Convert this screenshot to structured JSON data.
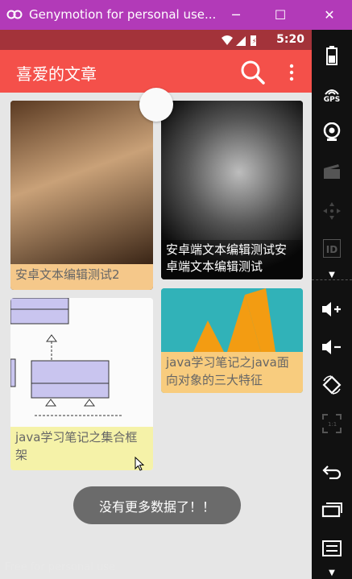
{
  "window": {
    "title": "Genymotion for personal use...",
    "minimize": "─",
    "maximize": "☐",
    "close": "✕"
  },
  "statusbar": {
    "time": "5:20"
  },
  "appbar": {
    "title": "喜爱的文章",
    "icons": [
      "search-icon",
      "more-vert-icon"
    ]
  },
  "cards": [
    {
      "caption": "安卓文本编辑测试2"
    },
    {
      "caption": "安卓端文本编辑测试安卓端文本编辑测试"
    },
    {
      "caption": "java学习笔记之java面向对象的三大特征"
    },
    {
      "caption": "java学习笔记之集合框架"
    }
  ],
  "toast": {
    "text": "没有更多数据了！！"
  },
  "watermark": "Free for personal use",
  "sidebar": {
    "gps_label": "GPS",
    "id_label": "ID",
    "scale_label": "1:1",
    "icons": [
      "battery-icon",
      "gps-icon",
      "camera-icon",
      "clapper-icon",
      "dpad-icon",
      "id-icon",
      "volume-up-icon",
      "volume-down-icon",
      "rotate-icon",
      "scale-icon",
      "back-icon",
      "recent-apps-icon",
      "menu-icon"
    ]
  },
  "colors": {
    "titlebar": "#b23ab8",
    "statusbar": "#a3333a",
    "appbar": "#f4504a",
    "toast": "#6b6b6b"
  }
}
